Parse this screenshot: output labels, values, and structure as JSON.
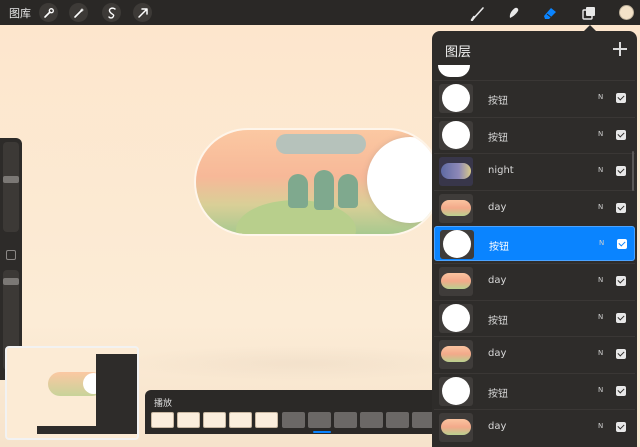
{
  "toolbar": {
    "gallery_label": "图库",
    "left_tools": [
      "wrench-icon",
      "magic-wand-icon",
      "selection-icon",
      "transform-arrow-icon"
    ],
    "right_tools": [
      "brush-icon",
      "smudge-icon",
      "eraser-icon",
      "layers-icon"
    ],
    "active_tool": "eraser-icon",
    "accent": "#0a84ff",
    "color_swatch": "#f3e2c8"
  },
  "timeline": {
    "title": "播放",
    "filled_frames": 5,
    "empty_frames": 6
  },
  "layers": {
    "title": "图层",
    "add_icon": "plus-icon",
    "items": [
      {
        "name": "按钮",
        "thumb": "circle",
        "blend": "N",
        "visible": true,
        "selected": false
      },
      {
        "name": "按钮",
        "thumb": "circle",
        "blend": "N",
        "visible": true,
        "selected": false
      },
      {
        "name": "night",
        "thumb": "night",
        "blend": "N",
        "visible": true,
        "selected": false
      },
      {
        "name": "day",
        "thumb": "day",
        "blend": "N",
        "visible": true,
        "selected": false
      },
      {
        "name": "按钮",
        "thumb": "circle",
        "blend": "N",
        "visible": true,
        "selected": true
      },
      {
        "name": "day",
        "thumb": "day",
        "blend": "N",
        "visible": true,
        "selected": false
      },
      {
        "name": "按钮",
        "thumb": "circle",
        "blend": "N",
        "visible": true,
        "selected": false
      },
      {
        "name": "day",
        "thumb": "day",
        "blend": "N",
        "visible": true,
        "selected": false
      },
      {
        "name": "按钮",
        "thumb": "circle",
        "blend": "N",
        "visible": true,
        "selected": false
      },
      {
        "name": "day",
        "thumb": "day",
        "blend": "N",
        "visible": true,
        "selected": false
      }
    ]
  }
}
